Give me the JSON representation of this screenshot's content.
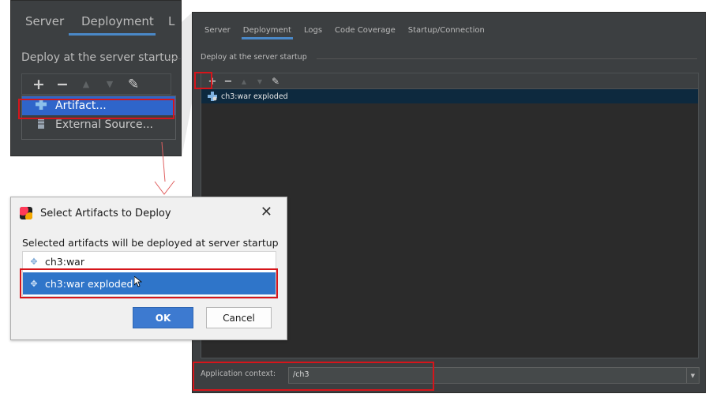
{
  "main": {
    "tabs": [
      {
        "label": "Server"
      },
      {
        "label": "Deployment"
      },
      {
        "label": "Logs"
      },
      {
        "label": "Code Coverage"
      },
      {
        "label": "Startup/Connection"
      }
    ],
    "active_tab": "Deployment",
    "section_title": "Deploy at the server startup",
    "toolbar": {
      "add": "+",
      "remove": "−",
      "up": "▲",
      "down": "▼",
      "edit": "✎"
    },
    "deployments": [
      {
        "label": "ch3:war exploded"
      }
    ],
    "app_context_label": "Application context:",
    "app_context_value": "/ch3",
    "combo_arrow": "▼"
  },
  "zoom": {
    "tabs": [
      {
        "label": "Server"
      },
      {
        "label": "Deployment"
      },
      {
        "label": "L"
      }
    ],
    "section_title": "Deploy at the server startup",
    "menu_items": [
      {
        "label": "Artifact..."
      },
      {
        "label": "External Source..."
      }
    ]
  },
  "dialog": {
    "title": "Select Artifacts to Deploy",
    "close": "✕",
    "subtitle": "Selected artifacts will be deployed at server startup",
    "items": [
      {
        "label": "ch3:war"
      },
      {
        "label": "ch3:war exploded"
      }
    ],
    "ok_label": "OK",
    "cancel_label": "Cancel"
  },
  "colors": {
    "ide_bg": "#3c3f41",
    "selection_dark": "#0d293e",
    "selection_blue": "#2f75c9",
    "highlight_red": "#d6151b",
    "tab_underline": "#4a88c7"
  }
}
